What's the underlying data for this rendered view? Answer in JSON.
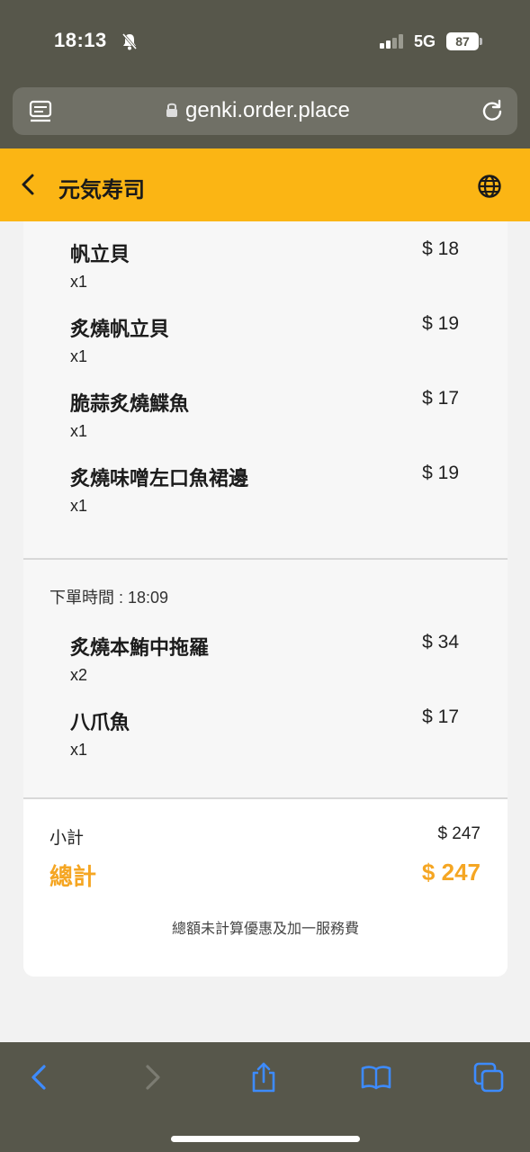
{
  "status_bar": {
    "time": "18:13",
    "network": "5G",
    "battery": "87"
  },
  "browser": {
    "url": "genki.order.place"
  },
  "header": {
    "title": "元気寿司"
  },
  "items_group1": [
    {
      "name": "帆立貝",
      "price": "$ 18",
      "qty": "x1"
    },
    {
      "name": "炙燒帆立貝",
      "price": "$ 19",
      "qty": "x1"
    },
    {
      "name": "脆蒜炙燒鰈魚",
      "price": "$ 17",
      "qty": "x1"
    },
    {
      "name": "炙燒味噌左口魚裙邊",
      "price": "$ 19",
      "qty": "x1"
    }
  ],
  "order_time": "下單時間 : 18:09",
  "items_group2": [
    {
      "name": "炙燒本鮪中拖羅",
      "price": "$ 34",
      "qty": "x2"
    },
    {
      "name": "八爪魚",
      "price": "$ 17",
      "qty": "x1"
    }
  ],
  "summary": {
    "subtotal_label": "小計",
    "subtotal_value": "$ 247",
    "total_label": "總計",
    "total_value": "$ 247",
    "note": "總額未計算優惠及加一服務費"
  },
  "colors": {
    "accent": "#fbb514",
    "total": "#f5a623",
    "chrome": "#57574b",
    "toolbar_blue": "#3d8bff"
  }
}
